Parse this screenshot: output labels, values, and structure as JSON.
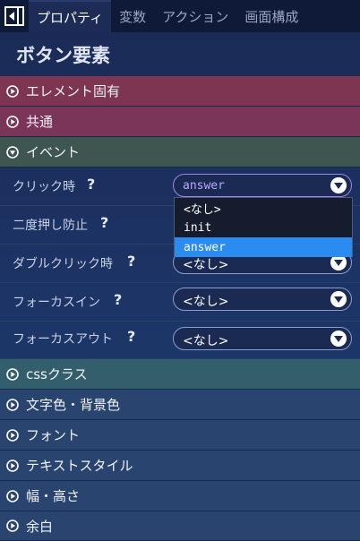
{
  "tabs": [
    {
      "label": "プロパティ"
    },
    {
      "label": "変数"
    },
    {
      "label": "アクション"
    },
    {
      "label": "画面構成"
    }
  ],
  "panel_title": "ボタン要素",
  "sections": {
    "element_specific": "エレメント固有",
    "common": "共通",
    "event": "イベント",
    "css_class": "cssクラス",
    "text_bg_color": "文字色・背景色",
    "font": "フォント",
    "text_style": "テキストスタイル",
    "size": "幅・高さ",
    "margin": "余白"
  },
  "event_props": [
    {
      "label": "クリック時",
      "value": "answer"
    },
    {
      "label": "二度押し防止",
      "value": ""
    },
    {
      "label": "ダブルクリック時",
      "value": "<なし>"
    },
    {
      "label": "フォーカスイン",
      "value": "<なし>"
    },
    {
      "label": "フォーカスアウト",
      "value": "<なし>"
    }
  ],
  "help_glyph": "?",
  "dropdown_options": [
    "<なし>",
    "init",
    "answer"
  ],
  "colors": {
    "element_specific_bg": "#7d3552",
    "common_bg": "#7a3558",
    "event_bg": "#3f5550",
    "css_class_bg": "#335f6c",
    "lower_section_bg": "#2a4470",
    "selected_option": "#2a8cf0"
  }
}
